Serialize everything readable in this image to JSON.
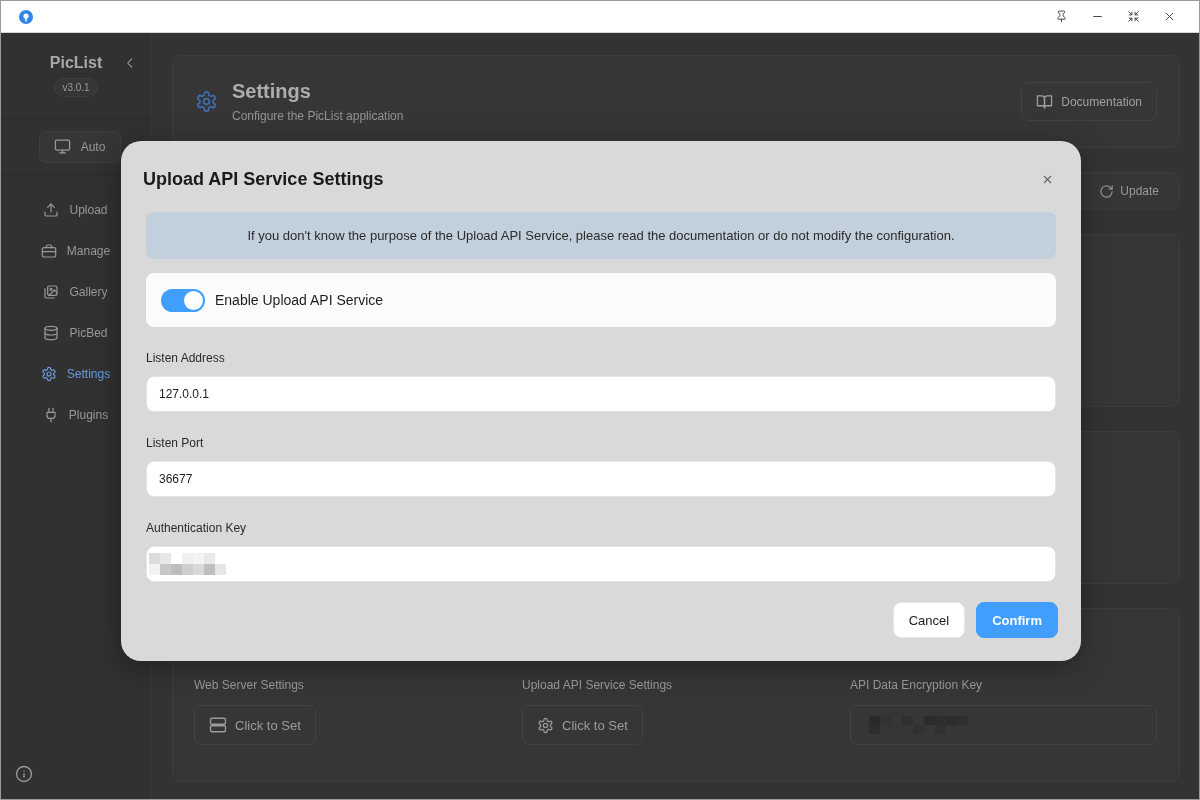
{
  "sidebar": {
    "app_name": "PicList",
    "version": "v3.0.1",
    "theme_button": "Auto",
    "items": [
      {
        "label": "Upload",
        "selected": false
      },
      {
        "label": "Manage",
        "selected": false
      },
      {
        "label": "Gallery",
        "selected": false
      },
      {
        "label": "PicBed",
        "selected": false
      },
      {
        "label": "Settings",
        "selected": true
      },
      {
        "label": "Plugins",
        "selected": false
      }
    ]
  },
  "header": {
    "title": "Settings",
    "subtitle": "Configure the PicList application",
    "button": "Documentation"
  },
  "tabs": [
    {
      "label": "Update",
      "selected": false
    }
  ],
  "server_settings": {
    "items": [
      {
        "kind": "button",
        "label": "Web Server Settings",
        "button": "Click to Set"
      },
      {
        "kind": "button",
        "label": "Upload API Service Settings",
        "button": "Click to Set"
      },
      {
        "kind": "redacted",
        "label": "API Data Encryption Key"
      }
    ]
  },
  "dialog": {
    "title": "Upload API Service Settings",
    "notice": "If you don't know the purpose of the Upload API Service, please read the documentation or do not modify the configuration.",
    "switch": {
      "label": "Enable Upload API Service",
      "on": true
    },
    "fields": [
      {
        "kind": "text",
        "label": "Listen Address",
        "value": "127.0.0.1"
      },
      {
        "kind": "text",
        "label": "Listen Port",
        "value": "36677"
      },
      {
        "kind": "redacted",
        "label": "Authentication Key"
      }
    ],
    "buttons": [
      {
        "kind": "secondary",
        "label": "Cancel"
      },
      {
        "kind": "primary",
        "label": "Confirm"
      }
    ]
  }
}
